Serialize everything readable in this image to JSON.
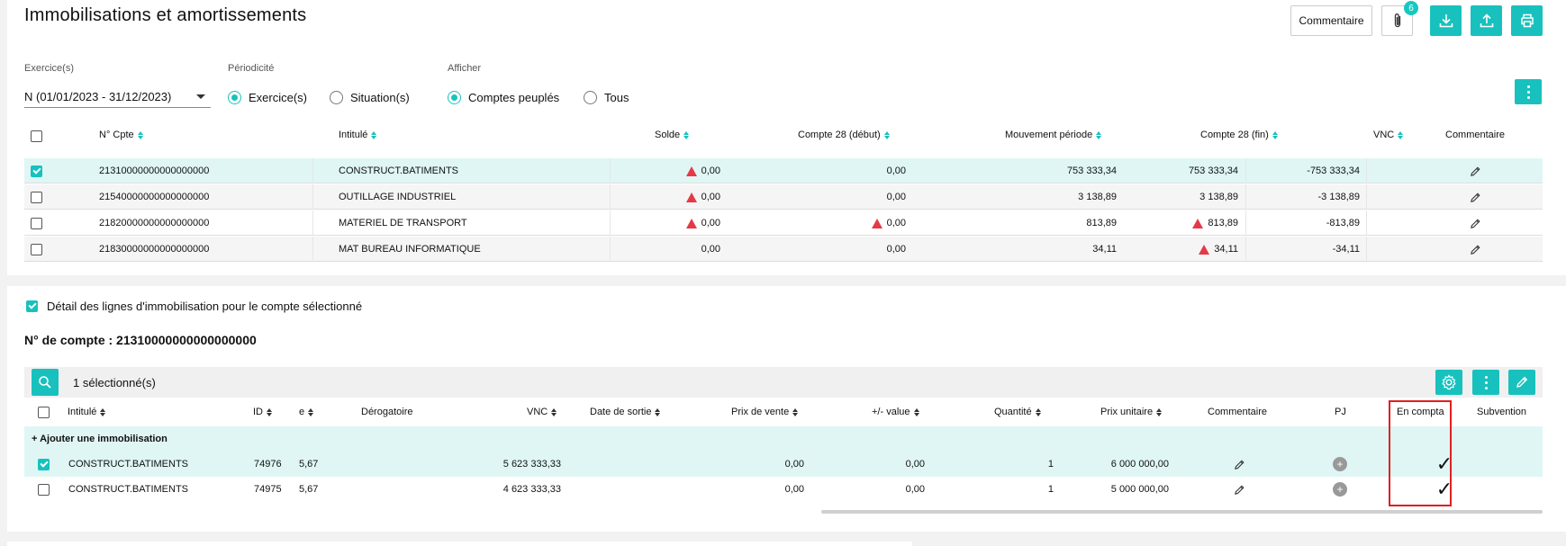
{
  "page": {
    "title": "Immobilisations et amortissements"
  },
  "toolbar": {
    "comment_label": "Commentaire",
    "attach_count": "6",
    "icons": [
      "paperclip-icon",
      "download-icon",
      "upload-icon",
      "print-icon"
    ]
  },
  "filters": {
    "exercice_label": "Exercice(s)",
    "exercice_value": "N (01/01/2023 - 31/12/2023)",
    "periodicite_label": "Périodicité",
    "periodicite_options": [
      "Exercice(s)",
      "Situation(s)"
    ],
    "periodicite_selected": "Exercice(s)",
    "afficher_label": "Afficher",
    "afficher_options": [
      "Comptes peuplés",
      "Tous"
    ],
    "afficher_selected": "Comptes peuplés"
  },
  "accounts_table": {
    "headers": [
      "N° Cpte",
      "Intitulé",
      "Solde",
      "Compte 28 (début)",
      "Mouvement période",
      "Compte 28 (fin)",
      "VNC",
      "Commentaire"
    ],
    "rows": [
      {
        "selected": true,
        "cpte": "21310000000000000000",
        "intitule": "CONSTRUCT.BATIMENTS",
        "solde": "0,00",
        "solde_warn": true,
        "c28_debut": "0,00",
        "c28_debut_warn": false,
        "mouvement": "753 333,34",
        "c28_fin": "753 333,34",
        "c28_fin_warn": false,
        "vnc": "-753 333,34"
      },
      {
        "selected": false,
        "cpte": "21540000000000000000",
        "intitule": "OUTILLAGE INDUSTRIEL",
        "solde": "0,00",
        "solde_warn": true,
        "c28_debut": "0,00",
        "c28_debut_warn": false,
        "mouvement": "3 138,89",
        "c28_fin": "3 138,89",
        "c28_fin_warn": false,
        "vnc": "-3 138,89"
      },
      {
        "selected": false,
        "cpte": "21820000000000000000",
        "intitule": "MATERIEL DE TRANSPORT",
        "solde": "0,00",
        "solde_warn": true,
        "c28_debut": "0,00",
        "c28_debut_warn": true,
        "mouvement": "813,89",
        "c28_fin": "813,89",
        "c28_fin_warn": true,
        "vnc": "-813,89"
      },
      {
        "selected": false,
        "cpte": "21830000000000000000",
        "intitule": "MAT BUREAU INFORMATIQUE",
        "solde": "0,00",
        "solde_warn": false,
        "c28_debut": "0,00",
        "c28_debut_warn": false,
        "mouvement": "34,11",
        "c28_fin": "34,11",
        "c28_fin_warn": true,
        "vnc": "-34,11"
      }
    ]
  },
  "detail": {
    "checkbox_label": "Détail des lignes d'immobilisation pour le compte sélectionné",
    "account_heading": "N° de compte : 21310000000000000000",
    "selected_count": "1 sélectionné(s)",
    "add_label": "+ Ajouter une immobilisation",
    "headers": [
      "Intitulé",
      "ID",
      "e",
      "Dérogatoire",
      "VNC",
      "Date de sortie",
      "Prix de vente",
      "+/- value",
      "Quantité",
      "Prix unitaire",
      "Commentaire",
      "PJ",
      "En compta",
      "Subvention"
    ],
    "rows": [
      {
        "selected": true,
        "intitule": "CONSTRUCT.BATIMENTS",
        "id": "74976",
        "e": "5,67",
        "vnc": "5 623 333,33",
        "prix_vente": "0,00",
        "plus_value": "0,00",
        "quantite": "1",
        "prix_unitaire": "6 000 000,00",
        "pj_plus": "+",
        "en_compta": "✓"
      },
      {
        "selected": false,
        "intitule": "CONSTRUCT.BATIMENTS",
        "id": "74975",
        "e": "5,67",
        "vnc": "4 623 333,33",
        "prix_vente": "0,00",
        "plus_value": "0,00",
        "quantite": "1",
        "prix_unitaire": "5 000 000,00",
        "pj_plus": "+",
        "en_compta": "✓"
      }
    ]
  },
  "colors": {
    "accent": "#18c1bd",
    "selected_row": "#dff6f5",
    "warning": "#e63946",
    "highlight_box": "#e02020"
  }
}
